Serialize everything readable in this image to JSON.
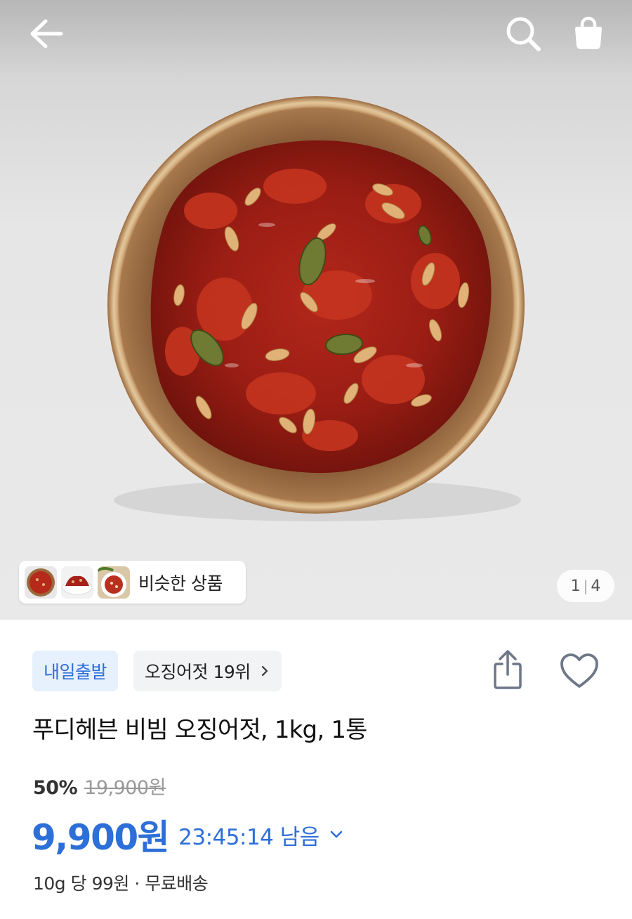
{
  "header": {
    "back_icon": "arrow-left-icon",
    "search_icon": "search-icon",
    "cart_icon": "shopping-bag-icon"
  },
  "gallery": {
    "similar_products_label": "비슷한 상품",
    "current_page": "1",
    "total_pages": "4"
  },
  "product": {
    "delivery_badge": "내일출발",
    "rank_badge": "오징어젓 19위",
    "title": "푸디헤븐 비빔 오징어젓, 1kg, 1통",
    "discount_rate": "50%",
    "original_price": "19,900원",
    "sale_price": "9,900원",
    "countdown": "23:45:14 남음",
    "unit_price": "10g 당 99원",
    "separator": "·",
    "shipping": "무료배송"
  },
  "colors": {
    "accent_blue": "#2d6fd8",
    "badge_blue_bg": "#e7f0fd",
    "muted_text": "#999999"
  }
}
